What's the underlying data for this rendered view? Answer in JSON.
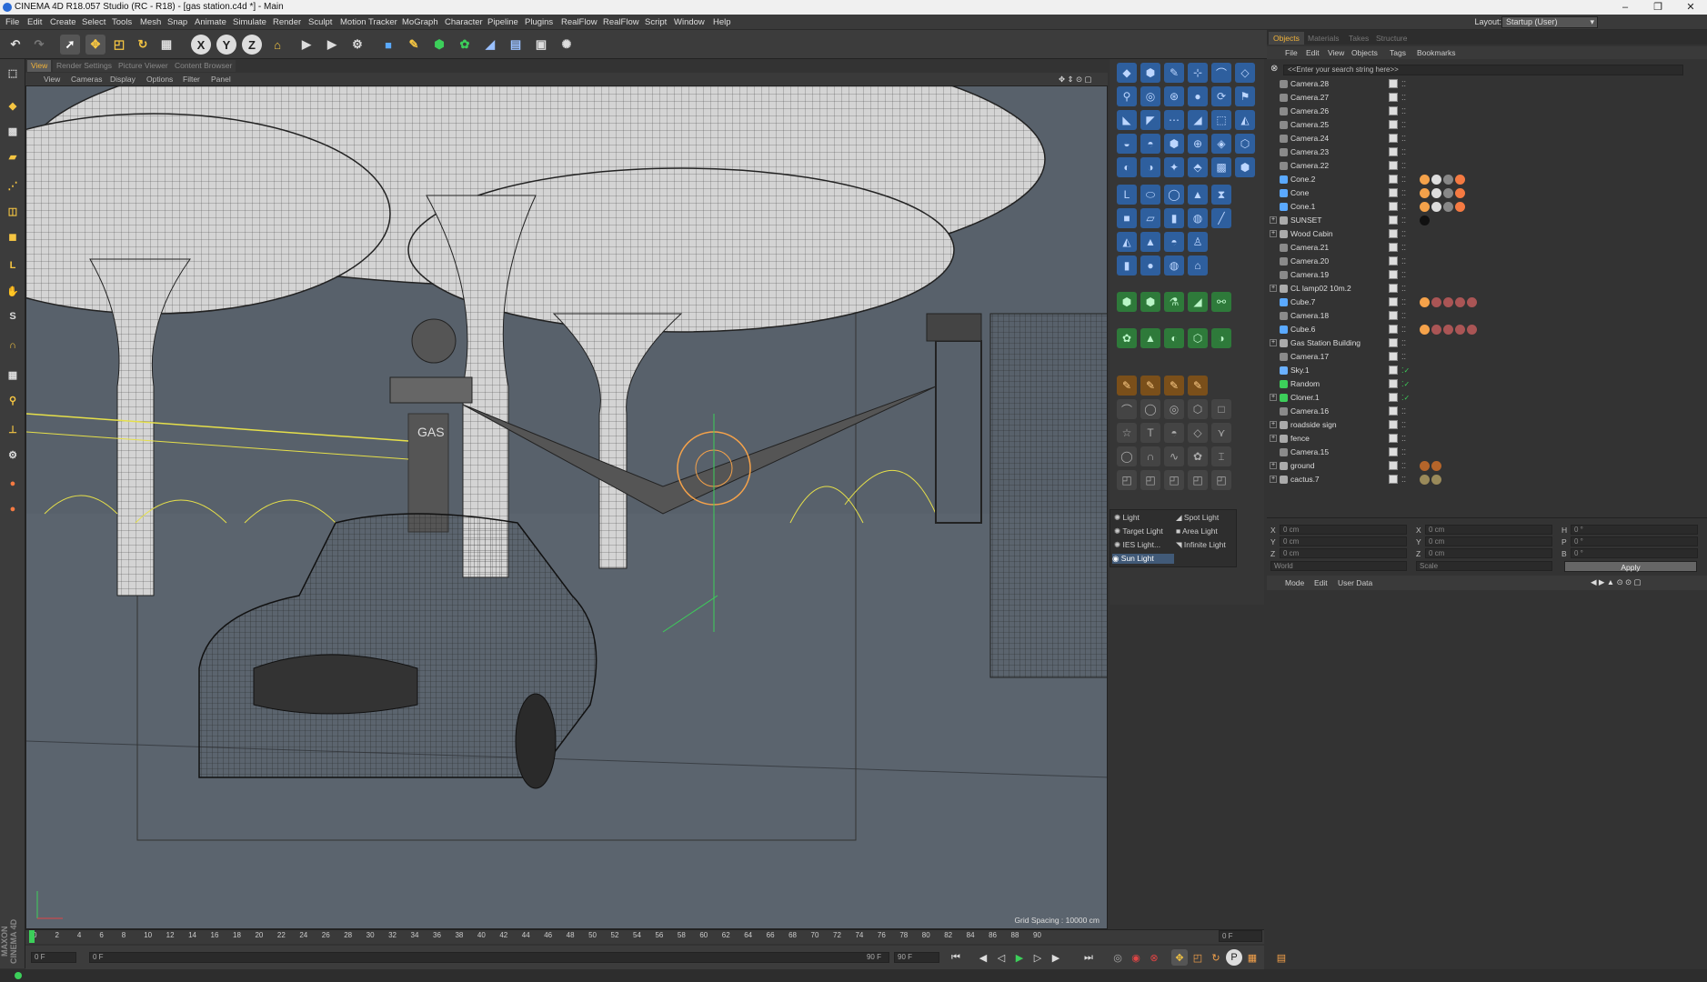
{
  "window": {
    "title": "CINEMA 4D R18.057 Studio (RC - R18) - [gas station.c4d *] - Main",
    "controls": [
      "–",
      "❐",
      "✕"
    ]
  },
  "menubar": {
    "items": [
      "File",
      "Edit",
      "Create",
      "Select",
      "Tools",
      "Mesh",
      "Snap",
      "Animate",
      "Simulate",
      "Render",
      "Sculpt",
      "Motion Tracker",
      "MoGraph",
      "Character",
      "Pipeline",
      "Plugins",
      "RealFlow",
      "RealFlow",
      "Script",
      "Window",
      "Help"
    ],
    "layout_label": "Layout:",
    "layout_value": "Startup (User)"
  },
  "toolbar": {
    "axis": [
      "X",
      "Y",
      "Z"
    ]
  },
  "viewport": {
    "tabs": [
      "View",
      "Render Settings",
      "Picture Viewer",
      "Content Browser"
    ],
    "menu": [
      "View",
      "Cameras",
      "Display",
      "Options",
      "Filter",
      "Panel"
    ],
    "grid_spacing": "Grid Spacing : 10000 cm"
  },
  "light_menu": {
    "items": [
      "Light",
      "Spot Light",
      "Target Light",
      "Area Light",
      "IES Light...",
      "Infinite Light",
      "Sun Light"
    ]
  },
  "object_manager": {
    "tabs": [
      "Objects",
      "Materials",
      "Takes",
      "Structure"
    ],
    "menu": [
      "File",
      "Edit",
      "View",
      "Objects",
      "Tags",
      "Bookmarks"
    ],
    "search_placeholder": "<<Enter your search string here>>",
    "objects": [
      {
        "name": "Camera.28",
        "type": "camera"
      },
      {
        "name": "Camera.27",
        "type": "camera"
      },
      {
        "name": "Camera.26",
        "type": "camera"
      },
      {
        "name": "Camera.25",
        "type": "camera"
      },
      {
        "name": "Camera.24",
        "type": "camera"
      },
      {
        "name": "Camera.23",
        "type": "camera"
      },
      {
        "name": "Camera.22",
        "type": "camera"
      },
      {
        "name": "Cone.2",
        "type": "primitive"
      },
      {
        "name": "Cone",
        "type": "primitive"
      },
      {
        "name": "Cone.1",
        "type": "primitive"
      },
      {
        "name": "SUNSET",
        "type": "null"
      },
      {
        "name": "Wood Cabin",
        "type": "null"
      },
      {
        "name": "Camera.21",
        "type": "camera"
      },
      {
        "name": "Camera.20",
        "type": "camera"
      },
      {
        "name": "Camera.19",
        "type": "camera"
      },
      {
        "name": "CL lamp02 10m.2",
        "type": "null"
      },
      {
        "name": "Cube.7",
        "type": "primitive"
      },
      {
        "name": "Camera.18",
        "type": "camera"
      },
      {
        "name": "Cube.6",
        "type": "primitive"
      },
      {
        "name": "Gas Station Building",
        "type": "null"
      },
      {
        "name": "Camera.17",
        "type": "camera"
      },
      {
        "name": "Sky.1",
        "type": "sky"
      },
      {
        "name": "Random",
        "type": "effector"
      },
      {
        "name": "Cloner.1",
        "type": "cloner"
      },
      {
        "name": "Camera.16",
        "type": "camera"
      },
      {
        "name": "roadside sign",
        "type": "null"
      },
      {
        "name": "fence",
        "type": "null"
      },
      {
        "name": "Camera.15",
        "type": "camera"
      },
      {
        "name": "ground",
        "type": "null"
      },
      {
        "name": "cactus.7",
        "type": "null"
      }
    ]
  },
  "coordinates": {
    "rows": [
      {
        "a": "X",
        "av": "0 cm",
        "b": "X",
        "bv": "0 cm",
        "c": "H",
        "cv": "0 °"
      },
      {
        "a": "Y",
        "av": "0 cm",
        "b": "Y",
        "bv": "0 cm",
        "c": "P",
        "cv": "0 °"
      },
      {
        "a": "Z",
        "av": "0 cm",
        "b": "Z",
        "bv": "0 cm",
        "c": "B",
        "cv": "0 °"
      }
    ],
    "space": "World",
    "mode": "Scale",
    "apply": "Apply"
  },
  "attributes": {
    "menu": [
      "Mode",
      "Edit",
      "User Data"
    ]
  },
  "timeline": {
    "ticks": [
      "0",
      "2",
      "4",
      "6",
      "8",
      "10",
      "12",
      "14",
      "16",
      "18",
      "20",
      "22",
      "24",
      "26",
      "28",
      "30",
      "32",
      "34",
      "36",
      "38",
      "40",
      "42",
      "44",
      "46",
      "48",
      "50",
      "52",
      "54",
      "56",
      "58",
      "60",
      "62",
      "64",
      "66",
      "68",
      "70",
      "72",
      "74",
      "76",
      "78",
      "80",
      "82",
      "84",
      "86",
      "88",
      "90"
    ],
    "current": "0 F",
    "start": "0 F",
    "range_start": "0 F",
    "range_end": "90 F",
    "end": "90 F"
  },
  "brand": "MAXON CINEMA 4D"
}
